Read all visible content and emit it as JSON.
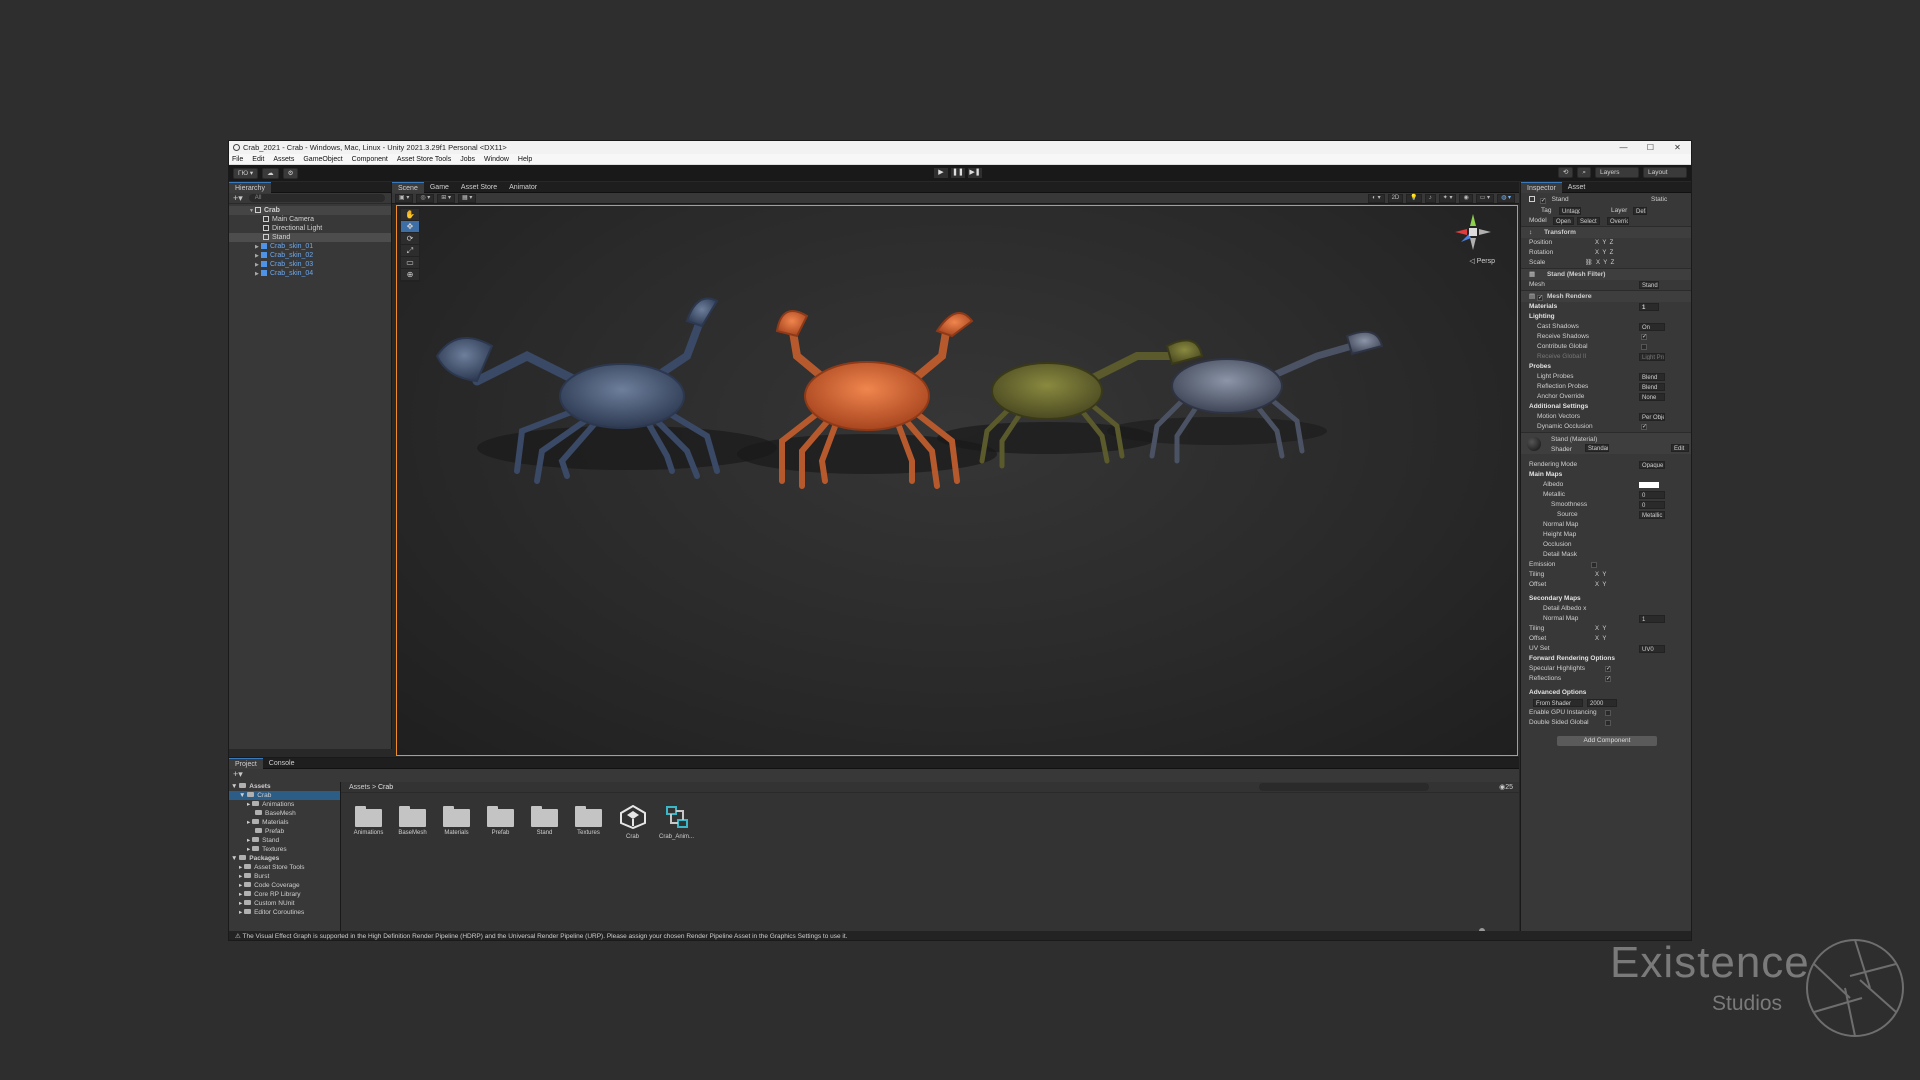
{
  "window": {
    "title": "Crab_2021 - Crab - Windows, Mac, Linux - Unity 2021.3.29f1 Personal <DX11>",
    "controls": [
      "—",
      "☐",
      "✕"
    ]
  },
  "menu": [
    "File",
    "Edit",
    "Assets",
    "GameObject",
    "Component",
    "Asset Store Tools",
    "Jobs",
    "Window",
    "Help"
  ],
  "toolbar": {
    "account": "ГЮ ▾",
    "layers": "Layers",
    "layout": "Layout"
  },
  "hierarchy": {
    "tab": "Hierarchy",
    "search_placeholder": "All",
    "items": [
      {
        "label": "Crab",
        "depth": 0
      },
      {
        "label": "Main Camera",
        "depth": 1
      },
      {
        "label": "Directional Light",
        "depth": 1
      },
      {
        "label": "Stand",
        "depth": 1
      },
      {
        "label": "Crab_skin_01",
        "depth": 1
      },
      {
        "label": "Crab_skin_02",
        "depth": 1
      },
      {
        "label": "Crab_skin_03",
        "depth": 1
      },
      {
        "label": "Crab_skin_04",
        "depth": 1
      }
    ]
  },
  "scene": {
    "tabs": [
      "Scene",
      "Game",
      "Asset Store",
      "Animator"
    ],
    "persp_label": "Persp",
    "mode_2d": "2D"
  },
  "inspector": {
    "tab": "Inspector",
    "tab2": "Asset",
    "object_name": "Stand",
    "static": "Static",
    "tag_label": "Tag",
    "tag_value": "Untagged",
    "layer_label": "Layer",
    "layer_value": "Default",
    "model_label": "Model",
    "model_open": "Open",
    "model_select": "Select",
    "model_overrides": "Overrides",
    "transform": "Transform",
    "position": "Position",
    "rotation": "Rotation",
    "scale": "Scale",
    "mesh_filter": "Stand (Mesh Filter)",
    "mesh_label": "Mesh",
    "mesh_value": "Stand",
    "mesh_renderer": "Mesh Renderer",
    "materials": "Materials",
    "materials_count": "1",
    "lighting": "Lighting",
    "cast_shadows": "Cast Shadows",
    "cast_shadows_val": "On",
    "receive_shadows": "Receive Shadows",
    "contribute_global": "Contribute Global",
    "receive_global": "Receive Global Il",
    "receive_global_val": "Light Probes",
    "probes": "Probes",
    "light_probes": "Light Probes",
    "light_probes_val": "Blend",
    "reflection_probes": "Reflection Probes",
    "reflection_probes_val": "Blend",
    "anchor_override": "Anchor Override",
    "anchor_override_val": "None",
    "additional_settings": "Additional Settings",
    "motion_vectors": "Motion Vectors",
    "motion_vectors_val": "Per Object",
    "dynamic_occlusion": "Dynamic Occlusion",
    "material_name": "Stand (Material)",
    "shader_label": "Shader",
    "shader_val": "Standard",
    "edit": "Edit",
    "rendering_mode": "Rendering Mode",
    "rendering_mode_val": "Opaque",
    "main_maps": "Main Maps",
    "albedo": "Albedo",
    "metallic": "Metallic",
    "metallic_val": "0",
    "smoothness": "Smoothness",
    "smoothness_val": "0",
    "source": "Source",
    "source_val": "Metallic",
    "normal_map": "Normal Map",
    "height_map": "Height Map",
    "occlusion": "Occlusion",
    "detail_mask": "Detail Mask",
    "emission": "Emission",
    "tiling": "Tiling",
    "offset": "Offset",
    "secondary_maps": "Secondary Maps",
    "detail_albedo": "Detail Albedo x",
    "normal_map2": "Normal Map",
    "normal_map2_val": "1",
    "uv_set": "UV Set",
    "uv_set_val": "UV0",
    "forward_rendering": "Forward Rendering Options",
    "specular_highlights": "Specular Highlights",
    "reflections": "Reflections",
    "advanced_options": "Advanced Options",
    "render_queue": "From Shader",
    "render_queue_val": "2000",
    "gpu_instancing": "Enable GPU Instancing",
    "double_sided": "Double Sided Global",
    "add_component": "Add Component"
  },
  "project": {
    "tabs": [
      "Project",
      "Console"
    ],
    "tree": [
      {
        "label": "Assets",
        "depth": 0
      },
      {
        "label": "Crab",
        "depth": 1
      },
      {
        "label": "Animations",
        "depth": 2
      },
      {
        "label": "BaseMesh",
        "depth": 2
      },
      {
        "label": "Materials",
        "depth": 2
      },
      {
        "label": "Prefab",
        "depth": 2
      },
      {
        "label": "Stand",
        "depth": 2
      },
      {
        "label": "Textures",
        "depth": 2
      },
      {
        "label": "Packages",
        "depth": 0
      },
      {
        "label": "Asset Store Tools",
        "depth": 1
      },
      {
        "label": "Burst",
        "depth": 1
      },
      {
        "label": "Code Coverage",
        "depth": 1
      },
      {
        "label": "Core RP Library",
        "depth": 1
      },
      {
        "label": "Custom NUnit",
        "depth": 1
      },
      {
        "label": "Editor Coroutines",
        "depth": 1
      }
    ],
    "breadcrumb": [
      "Assets",
      "Crab"
    ],
    "assets": [
      {
        "label": "Animations",
        "kind": "folder"
      },
      {
        "label": "BaseMesh",
        "kind": "folder"
      },
      {
        "label": "Materials",
        "kind": "folder"
      },
      {
        "label": "Prefab",
        "kind": "folder"
      },
      {
        "label": "Stand",
        "kind": "folder"
      },
      {
        "label": "Textures",
        "kind": "folder"
      },
      {
        "label": "Crab",
        "kind": "unity"
      },
      {
        "label": "Crab_Anim...",
        "kind": "anim"
      }
    ],
    "count": "25"
  },
  "status": "The Visual Effect Graph is supported in the High Definition Render Pipeline (HDRP) and the Universal Render Pipeline (URP). Please assign your chosen Render Pipeline Asset in the Graphics Settings to use it.",
  "watermark": {
    "line1": "Existence",
    "line2": "Studios"
  },
  "colors": {
    "accent": "#f28c28",
    "selection": "#2c5d87",
    "prefab_blue": "#6ba8f0"
  }
}
